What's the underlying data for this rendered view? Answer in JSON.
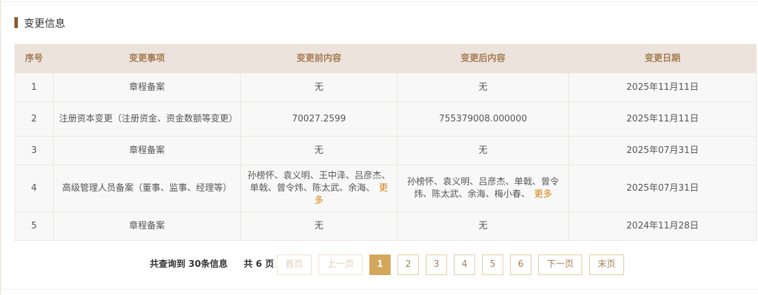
{
  "section": {
    "title": "变更信息"
  },
  "table": {
    "headers": [
      "序号",
      "变更事项",
      "变更前内容",
      "变更后内容",
      "变更日期"
    ],
    "rows": [
      {
        "index": "1",
        "item": "章程备案",
        "before": "无",
        "after": "无",
        "date": "2025年11月11日"
      },
      {
        "index": "2",
        "item": "注册资本变更（注册资金、资金数额等变更）",
        "before": "70027.2599",
        "after": "755379008.000000",
        "date": "2025年11月11日"
      },
      {
        "index": "3",
        "item": "章程备案",
        "before": "无",
        "after": "无",
        "date": "2025年07月31日"
      },
      {
        "index": "4",
        "item": "高级管理人员备案（董事、监事、经理等）",
        "before": "孙榜怀、袁义明、王中泽、吕彦杰、单戟、曾令炜、陈太武、余海、",
        "after": "孙榜怀、袁义明、吕彦杰、单戟、曾令炜、陈太武、余海、梅小春、",
        "date": "2025年07月31日"
      },
      {
        "index": "5",
        "item": "章程备案",
        "before": "无",
        "after": "无",
        "date": "2024年11月28日"
      }
    ],
    "more_label": "更多"
  },
  "pagination": {
    "total_text": "共查询到 30条信息",
    "pages_text": "共 6 页",
    "first": "首页",
    "prev": "上一页",
    "pages": [
      "1",
      "2",
      "3",
      "4",
      "5",
      "6"
    ],
    "current": "1",
    "next": "下一页",
    "last": "末页"
  }
}
